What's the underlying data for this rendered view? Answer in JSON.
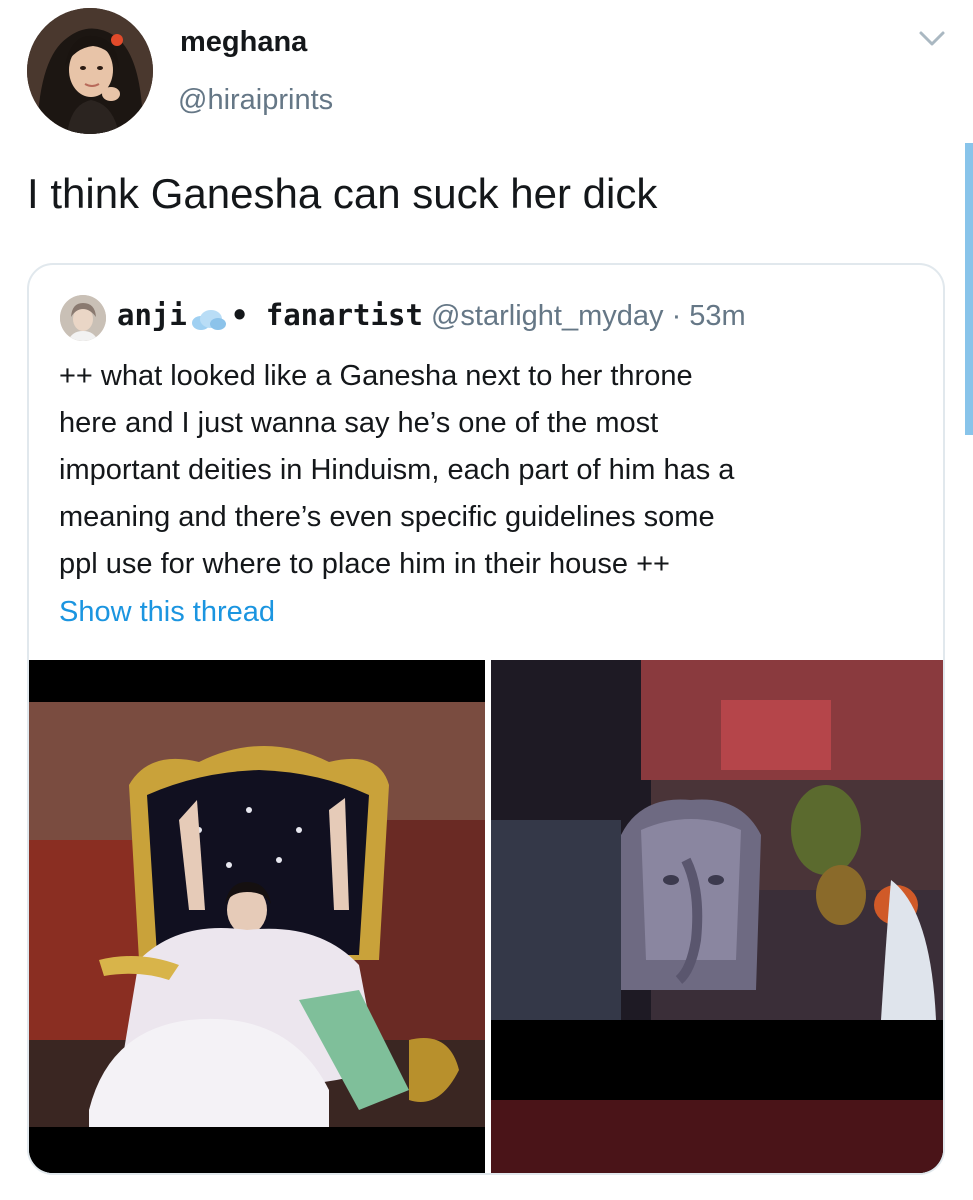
{
  "tweet": {
    "display_name": "meghana",
    "handle": "@hiraiprints",
    "text": "I think Ganesha can suck her dick"
  },
  "quoted_tweet": {
    "display_name": "anji",
    "display_name_suffix": "• fanartist",
    "handle": "@starlight_myday",
    "separator": "·",
    "time": "53m",
    "text_lines": [
      "++ what looked like a Ganesha next to her throne",
      "here and I just wanna say he’s one of the most",
      "important deities in Hinduism, each part of him has a",
      "meaning and there’s even specific guidelines some",
      "ppl use for where to place him in their house ++"
    ],
    "show_thread": "Show this thread"
  },
  "icons": {
    "menu": "chevron-down-icon",
    "name_emoji": "cloud-icon"
  },
  "colors": {
    "link": "#1b95e0",
    "secondary_text": "#657786",
    "border": "#e1e8ed",
    "scroll_indicator": "#88c4ea"
  }
}
